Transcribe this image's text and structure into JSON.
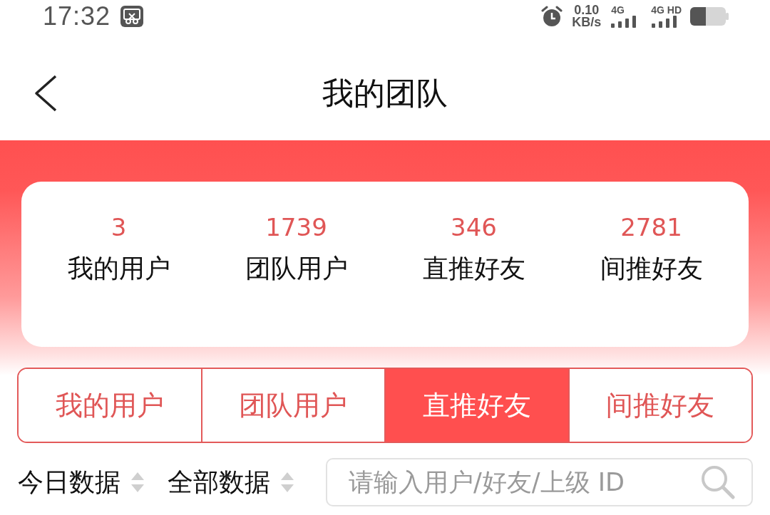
{
  "status_bar": {
    "time": "17:32",
    "network_speed": {
      "value": "0.10",
      "unit": "KB/s"
    },
    "signals": [
      {
        "label": "4G"
      },
      {
        "label": "4G HD"
      }
    ]
  },
  "nav": {
    "title": "我的团队"
  },
  "stats": [
    {
      "value": "3",
      "label": "我的用户"
    },
    {
      "value": "1739",
      "label": "团队用户"
    },
    {
      "value": "346",
      "label": "直推好友"
    },
    {
      "value": "2781",
      "label": "间推好友"
    }
  ],
  "tabs": [
    {
      "label": "我的用户",
      "selected": false
    },
    {
      "label": "团队用户",
      "selected": false
    },
    {
      "label": "直推好友",
      "selected": true
    },
    {
      "label": "间推好友",
      "selected": false
    }
  ],
  "filters": [
    {
      "label": "今日数据"
    },
    {
      "label": "全部数据"
    }
  ],
  "search": {
    "placeholder": "请输入用户/好友/上级 ID"
  }
}
